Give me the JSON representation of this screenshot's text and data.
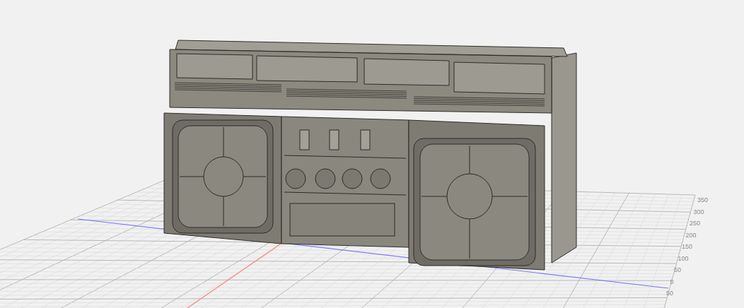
{
  "viewport": {
    "axis_labels": [
      {
        "text": "350"
      },
      {
        "text": "300"
      },
      {
        "text": "250"
      },
      {
        "text": "200"
      },
      {
        "text": "150"
      },
      {
        "text": "100"
      },
      {
        "text": "50"
      },
      {
        "text": "0"
      },
      {
        "text": "50"
      }
    ]
  }
}
